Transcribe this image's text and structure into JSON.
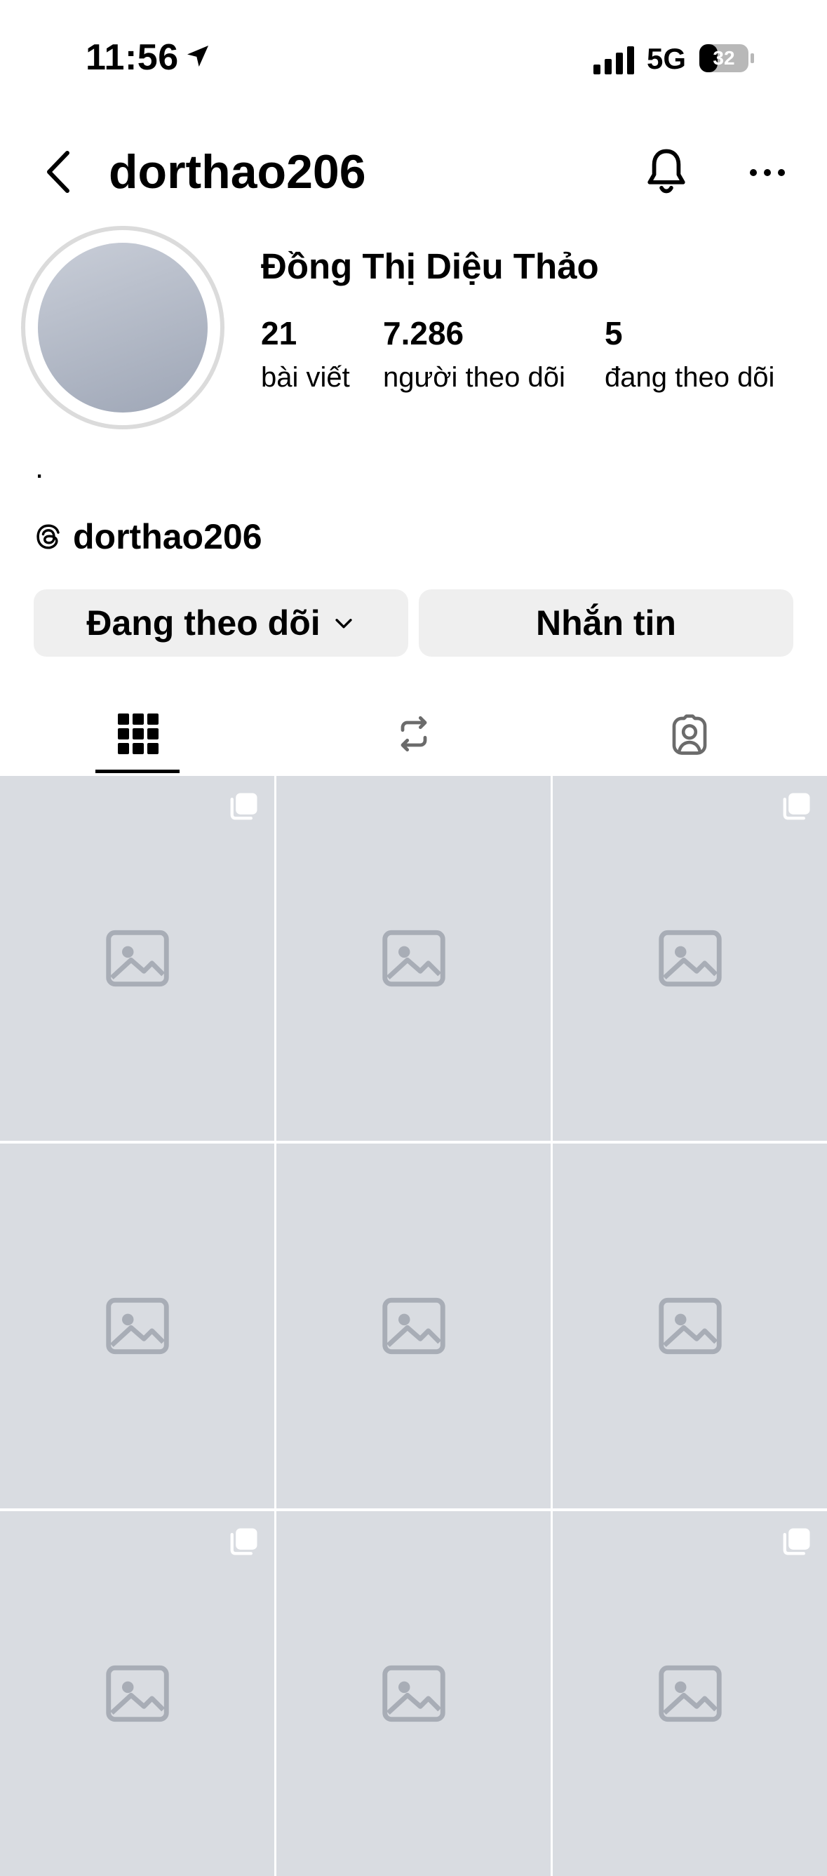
{
  "status_bar": {
    "time": "11:56",
    "location_icon": "location-arrow-icon",
    "network": "5G",
    "battery": "32"
  },
  "header": {
    "username": "dorthao206",
    "back_icon": "chevron-left-icon",
    "bell_icon": "bell-icon",
    "more_icon": "ellipsis-icon"
  },
  "profile": {
    "full_name": "Đồng Thị Diệu Thảo",
    "stats": {
      "posts": {
        "count": "21",
        "label": "bài viết"
      },
      "followers": {
        "count": "7.286",
        "label": "người theo dõi"
      },
      "following": {
        "count": "5",
        "label": "đang theo dõi"
      }
    },
    "bio": ".",
    "threads_handle": "dorthao206"
  },
  "actions": {
    "following_label": "Đang theo dõi",
    "message_label": "Nhắn tin"
  },
  "tabs": [
    {
      "name": "grid",
      "icon": "grid-icon",
      "active": true
    },
    {
      "name": "reposts",
      "icon": "repost-icon",
      "active": false
    },
    {
      "name": "tagged",
      "icon": "tagged-person-icon",
      "active": false
    }
  ],
  "grid": {
    "tiles": [
      {
        "carousel": true
      },
      {
        "carousel": false
      },
      {
        "carousel": true
      },
      {
        "carousel": false
      },
      {
        "carousel": false
      },
      {
        "carousel": false
      },
      {
        "carousel": true
      },
      {
        "carousel": false
      },
      {
        "carousel": true
      }
    ]
  }
}
